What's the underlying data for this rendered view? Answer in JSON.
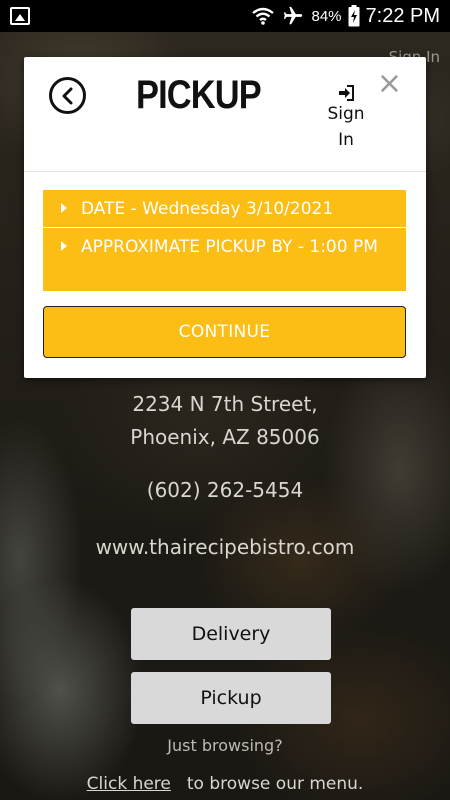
{
  "status_bar": {
    "battery": "84%",
    "time": "7:22 PM"
  },
  "background": {
    "ghost_signin": "Sign In",
    "address_line1": "2234 N 7th Street,",
    "address_line2": "Phoenix, AZ 85006",
    "phone": "(602) 262-5454",
    "website": "www.thairecipebistro.com",
    "delivery_label": "Delivery",
    "pickup_label": "Pickup",
    "browsing_text": "Just browsing?",
    "click_here": "Click here",
    "browse_menu": "to browse our menu."
  },
  "modal": {
    "title": "PICKUP",
    "signin_line1": "Sign",
    "signin_line2": "In",
    "close": "×",
    "options": [
      {
        "label": "DATE - Wednesday 3/10/2021"
      },
      {
        "label": "APPROXIMATE PICKUP BY - 1:00 PM"
      }
    ],
    "continue_label": "CONTINUE"
  },
  "colors": {
    "accent": "#fcbd14",
    "title": "#111111"
  },
  "icons": [
    "image-icon",
    "wifi-icon",
    "airplane-icon",
    "battery-icon",
    "back-arrow-icon",
    "sign-in-icon",
    "close-icon",
    "caret-right-icon"
  ]
}
